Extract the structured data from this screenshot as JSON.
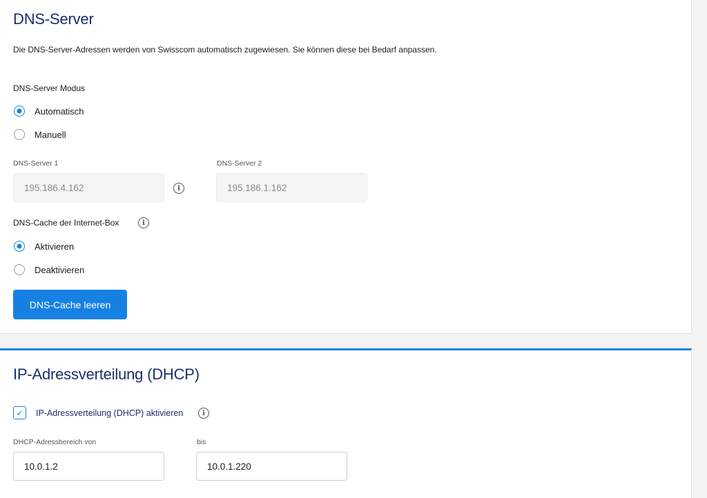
{
  "dns": {
    "title": "DNS-Server",
    "description": "Die DNS-Server-Adressen werden von Swisscom automatisch zugewiesen. Sie können diese bei Bedarf anpassen.",
    "mode_label": "DNS-Server Modus",
    "mode_options": [
      "Automatisch",
      "Manuell"
    ],
    "mode_selected": "Automatisch",
    "server1_label": "DNS-Server 1",
    "server1_value": "195.186.4.162",
    "server2_label": "DNS-Server 2",
    "server2_value": "195.186.1.162",
    "cache_label": "DNS-Cache der Internet-Box",
    "cache_options": [
      "Aktivieren",
      "Deaktivieren"
    ],
    "cache_selected": "Aktivieren",
    "flush_button": "DNS-Cache leeren"
  },
  "dhcp": {
    "title": "IP-Adressverteilung (DHCP)",
    "enable_label": "IP-Adressverteilung (DHCP) aktivieren",
    "enabled": true,
    "range_from_label": "DHCP-Adressbereich von",
    "range_from_value": "10.0.1.2",
    "range_to_label": "bis",
    "range_to_value": "10.0.1.220"
  },
  "icons": {
    "info": "info-icon",
    "check": "checkmark-icon"
  },
  "colors": {
    "accent": "#1781e3",
    "heading": "#1a2f6b"
  }
}
